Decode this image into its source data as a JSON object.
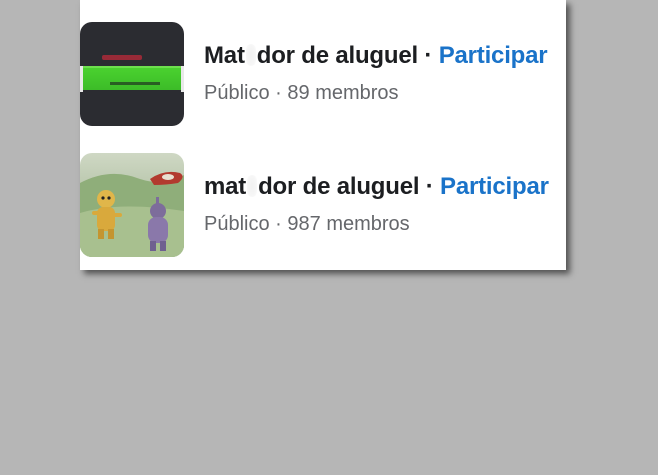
{
  "groups": [
    {
      "name_start": "Mat",
      "name_end": "dor de aluguel",
      "separator": "·",
      "join_label": "Participar",
      "visibility": "Público",
      "meta_separator": "·",
      "members": "89 membros",
      "thumbnail": "dark-image-with-green-band"
    },
    {
      "name_start": "mat",
      "name_end": "dor de aluguel",
      "separator": "·",
      "join_label": "Participar",
      "visibility": "Público",
      "meta_separator": "·",
      "members": "987 membros",
      "thumbnail": "cartoon-characters-scene"
    }
  ],
  "colors": {
    "background": "#b6b6b6",
    "card": "#ffffff",
    "title": "#1c1e21",
    "link": "#1a73c9",
    "meta": "#65676b"
  }
}
